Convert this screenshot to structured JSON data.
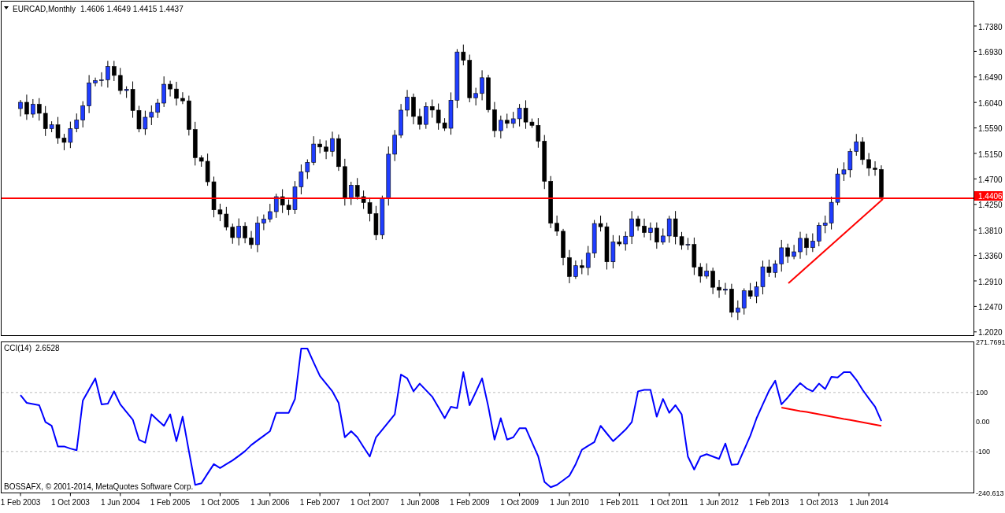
{
  "chart": {
    "symbol": "EURCAD,Monthly",
    "ohlc": "1.4606 1.4649 1.4415 1.4437",
    "price_axis": [
      "1.7380",
      "1.6930",
      "1.6490",
      "1.6040",
      "1.5590",
      "1.5150",
      "1.4700",
      "1.4250",
      "1.3810",
      "1.3360",
      "1.2910",
      "1.2470",
      "1.2020"
    ],
    "price_level": "1.4406"
  },
  "indicator": {
    "value": "2.6528",
    "chart_data": {
      "type": "line",
      "ylim": [
        -240.613,
        271.7691
      ],
      "categories": [
        "1 Feb 2003",
        null,
        null,
        null,
        null,
        null,
        null,
        null,
        "1 Oct 2003",
        null,
        null,
        null,
        null,
        null,
        null,
        null,
        "1 Jun 2004",
        null,
        null,
        null,
        null,
        null,
        null,
        null,
        "1 Feb 2005",
        null,
        null,
        null,
        null,
        null,
        null,
        null,
        "1 Oct 2005",
        null,
        null,
        null,
        null,
        null,
        null,
        null,
        "1 Jun 2006",
        null,
        null,
        null,
        null,
        null,
        null,
        null,
        "1 Feb 2007",
        null,
        null,
        null,
        null,
        null,
        null,
        null,
        "1 Oct 2007",
        null,
        null,
        null,
        null,
        null,
        null,
        null,
        "1 Jun 2008",
        null,
        null,
        null,
        null,
        null,
        null,
        null,
        "1 Feb 2009",
        null,
        null,
        null,
        null,
        null,
        null,
        null,
        "1 Oct 2009",
        null,
        null,
        null,
        null,
        null,
        null,
        null,
        "1 Jun 2010",
        null,
        null,
        null,
        null,
        null,
        null,
        null,
        "1 Feb 2011",
        null,
        null,
        null,
        null,
        null,
        null,
        null,
        "1 Oct 2011",
        null,
        null,
        null,
        null,
        null,
        null,
        null,
        "1 Jun 2012",
        null,
        null,
        null,
        null,
        null,
        null,
        null,
        "1 Feb 2013",
        null,
        null,
        null,
        null,
        null,
        null,
        null,
        "1 Oct 2013",
        null,
        null,
        null,
        null,
        null,
        null,
        null,
        "1 Jun 2014",
        null,
        null
      ],
      "series": [
        {
          "name": "CCI(14)",
          "color": "#0000ff",
          "values": [
            91,
            65,
            61,
            57,
            0,
            -13,
            -83,
            -83,
            -90,
            -96,
            73,
            110,
            148,
            60,
            62,
            104,
            60,
            34,
            8,
            -60,
            -70,
            26,
            6,
            -13,
            26,
            -65,
            18,
            -98,
            -213,
            -208,
            -175,
            -143,
            -156,
            -143,
            -130,
            -115,
            -99,
            -78,
            -62,
            -47,
            -31,
            31,
            31,
            31,
            78,
            249,
            249,
            202,
            156,
            130,
            104,
            65,
            -52,
            -31,
            -52,
            -85,
            -117,
            -52,
            -26,
            0,
            26,
            161,
            148,
            104,
            130,
            108,
            86,
            50,
            13,
            52,
            47,
            169,
            57,
            102,
            148,
            52,
            -60,
            13,
            -60,
            -52,
            -21,
            -21,
            -69,
            -117,
            -203,
            -221,
            -213,
            -198,
            -182,
            -143,
            -94,
            -81,
            -68,
            -13,
            -39,
            -65,
            -46,
            -26,
            0,
            104,
            109,
            109,
            18,
            78,
            31,
            57,
            26,
            -117,
            -161,
            -117,
            -109,
            -117,
            -125,
            -73,
            -145,
            -143,
            -95,
            -47,
            13,
            60,
            106,
            140,
            60,
            83,
            109,
            132,
            114,
            104,
            130,
            112,
            153,
            151,
            169,
            169,
            143,
            109,
            80,
            52,
            3
          ]
        },
        {
          "color": "#ff0000",
          "values": [
            null,
            null,
            null,
            null,
            null,
            null,
            null,
            null,
            null,
            null,
            null,
            null,
            null,
            null,
            null,
            null,
            null,
            null,
            null,
            null,
            null,
            null,
            null,
            null,
            null,
            null,
            null,
            null,
            null,
            null,
            null,
            null,
            null,
            null,
            null,
            null,
            null,
            null,
            null,
            null,
            null,
            null,
            null,
            null,
            null,
            null,
            null,
            null,
            null,
            null,
            null,
            null,
            null,
            null,
            null,
            null,
            null,
            null,
            null,
            null,
            null,
            null,
            null,
            null,
            null,
            null,
            null,
            null,
            null,
            null,
            null,
            null,
            null,
            null,
            null,
            null,
            null,
            null,
            null,
            null,
            null,
            null,
            null,
            null,
            null,
            null,
            null,
            null,
            null,
            null,
            null,
            null,
            null,
            null,
            null,
            null,
            null,
            null,
            null,
            null,
            null,
            null,
            null,
            null,
            null,
            null,
            null,
            null,
            null,
            null,
            null,
            null,
            null,
            null,
            null,
            null,
            null,
            null,
            null,
            null,
            null,
            null,
            49,
            45,
            41,
            37,
            34,
            30,
            26,
            22,
            18,
            14,
            10,
            7,
            3,
            -1,
            -5,
            -9,
            -13
          ]
        }
      ],
      "yticks": [
        {
          "value": 271.7691,
          "label": "271.7691"
        },
        {
          "value": 100,
          "label": "100"
        },
        {
          "value": 0,
          "label": "0.00"
        },
        {
          "value": -100,
          "label": "-100"
        },
        {
          "value": -240.613,
          "label": "-240.613"
        }
      ]
    }
  },
  "copyright": "BOSSAFX, © 2001-2014, MetaQuotes Software Corp."
}
